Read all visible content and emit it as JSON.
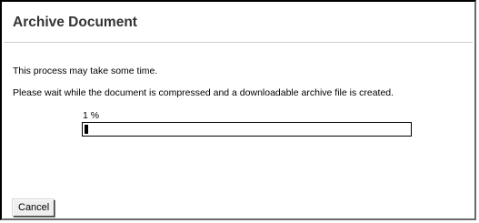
{
  "dialog": {
    "title": "Archive Document",
    "message_1": "This process may take some time.",
    "message_2": "Please wait while the document is compressed and a downloadable archive file is created."
  },
  "progress": {
    "label": "1 %",
    "value": 0.01
  },
  "buttons": {
    "cancel_label": "Cancel"
  }
}
